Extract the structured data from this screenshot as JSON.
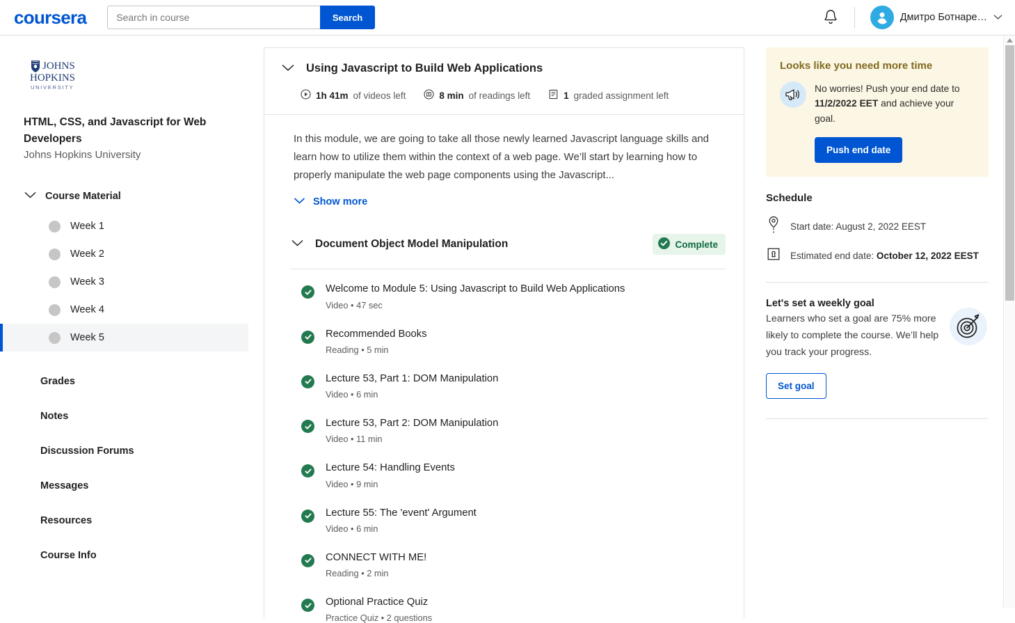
{
  "header": {
    "logo_text": "coursera",
    "search": {
      "placeholder": "Search in course",
      "value": "",
      "button_label": "Search"
    },
    "notification_icon": "bell-icon",
    "user_name": "Дмитро Ботнаре…"
  },
  "sidebar": {
    "university_logo": "johns-hopkins-university-logo",
    "course_title": "HTML, CSS, and Javascript for Web Developers",
    "course_org": "Johns Hopkins University",
    "course_material_label": "Course Material",
    "weeks": [
      {
        "label": "Week 1",
        "active": false
      },
      {
        "label": "Week 2",
        "active": false
      },
      {
        "label": "Week 3",
        "active": false
      },
      {
        "label": "Week 4",
        "active": false
      },
      {
        "label": "Week 5",
        "active": true
      }
    ],
    "nav_items": [
      {
        "label": "Grades"
      },
      {
        "label": "Notes"
      },
      {
        "label": "Discussion Forums"
      },
      {
        "label": "Messages"
      },
      {
        "label": "Resources"
      },
      {
        "label": "Course Info"
      }
    ]
  },
  "main": {
    "module_title": "Using Javascript to Build Web Applications",
    "stats": [
      {
        "icon": "play-circle-icon",
        "value": "1h 41m",
        "label": "of videos left"
      },
      {
        "icon": "reading-icon",
        "value": "8 min",
        "label": "of readings left"
      },
      {
        "icon": "assignment-icon",
        "value": "1",
        "label": "graded assignment left"
      }
    ],
    "description": "In this module, we are going to take all those newly learned Javascript language skills and learn how to utilize them within the context of a web page. We’ll start by learning how to properly manipulate the web page components using the Javascript...",
    "show_more_label": "Show more",
    "lesson_group_title": "Document Object Model Manipulation",
    "lesson_group_status": "Complete",
    "lessons": [
      {
        "name": "Welcome to Module 5: Using Javascript to Build Web Applications",
        "meta": "Video • 47 sec",
        "complete": true
      },
      {
        "name": "Recommended Books",
        "meta": "Reading • 5 min",
        "complete": true
      },
      {
        "name": "Lecture 53, Part 1: DOM Manipulation",
        "meta": "Video • 6 min",
        "complete": true
      },
      {
        "name": "Lecture 53, Part 2: DOM Manipulation",
        "meta": "Video • 11 min",
        "complete": true
      },
      {
        "name": "Lecture 54: Handling Events",
        "meta": "Video • 9 min",
        "complete": true
      },
      {
        "name": "Lecture 55: The 'event' Argument",
        "meta": "Video • 6 min",
        "complete": true
      },
      {
        "name": "CONNECT WITH ME!",
        "meta": "Reading • 2 min",
        "complete": true
      },
      {
        "name": "Optional Practice Quiz",
        "meta": "Practice Quiz • 2 questions",
        "complete": true
      }
    ]
  },
  "right_panel": {
    "notice": {
      "title": "Looks like you need more time",
      "text_before": "No worries! Push your end date to ",
      "date": "11/2/2022 EET",
      "text_after": " and achieve your goal.",
      "button_label": "Push end date",
      "icon": "megaphone-icon"
    },
    "schedule": {
      "title": "Schedule",
      "start_label": "Start date: August 2, 2022 EEST",
      "end_label_prefix": "Estimated end date: ",
      "end_date": "October 12, 2022 EEST",
      "start_icon": "location-pin-icon",
      "end_icon": "flag-badge-icon"
    },
    "goal": {
      "title": "Let's set a weekly goal",
      "text": "Learners who set a goal are 75% more likely to complete the course. We’ll help you track your progress.",
      "button_label": "Set goal",
      "icon": "target-icon"
    }
  },
  "colors": {
    "brand_blue": "#0056d2",
    "complete_green": "#237a50",
    "badge_bg": "#e6f4ea",
    "notice_bg": "#fcf6e4",
    "notice_title": "#806a1f"
  }
}
